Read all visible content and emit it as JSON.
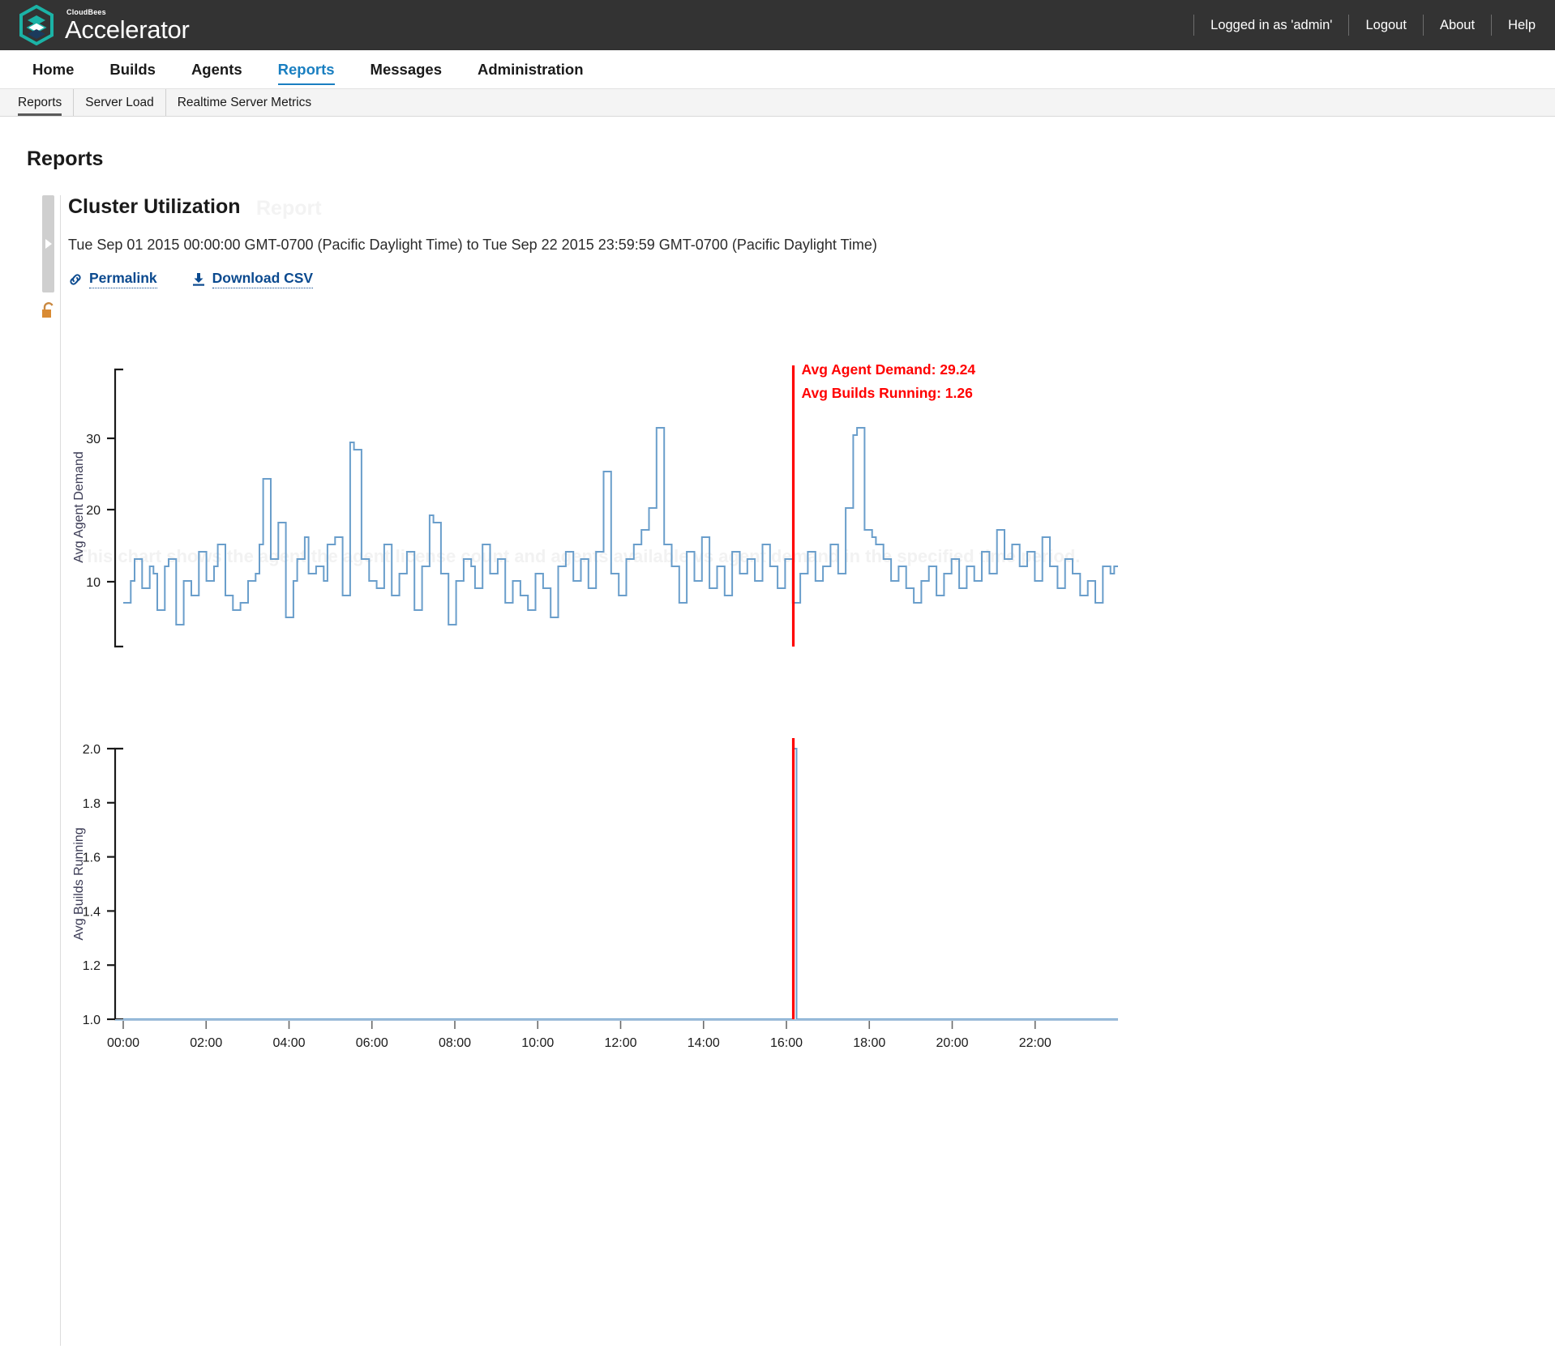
{
  "brand": {
    "sub": "CloudBees",
    "main": "Accelerator",
    "logo_icon": "cloudbees-hexagon-logo",
    "accent": "#1bb3a6"
  },
  "topbar": {
    "background": "#333333",
    "logged_in_as": "Logged in as 'admin'",
    "logout": "Logout",
    "about": "About",
    "help": "Help"
  },
  "mainnav": {
    "items": [
      {
        "label": "Home",
        "active": false
      },
      {
        "label": "Builds",
        "active": false
      },
      {
        "label": "Agents",
        "active": false
      },
      {
        "label": "Reports",
        "active": true
      },
      {
        "label": "Messages",
        "active": false
      },
      {
        "label": "Administration",
        "active": false
      }
    ],
    "active_color": "#1a7fc1"
  },
  "subnav": {
    "items": [
      {
        "label": "Reports",
        "active": true
      },
      {
        "label": "Server Load",
        "active": false
      },
      {
        "label": "Realtime Server Metrics",
        "active": false
      }
    ]
  },
  "page": {
    "title": "Reports"
  },
  "report": {
    "name": "Cluster Utilization",
    "ghost_title": "Report",
    "ghost_description": "This chart shows the agent the agent license count and agents available vs agent demand in the specified time period.",
    "date_range": "Tue Sep 01 2015 00:00:00 GMT-0700 (Pacific Daylight Time) to Tue Sep 22 2015 23:59:59 GMT-0700 (Pacific Daylight Time)",
    "permalink_label": "Permalink",
    "permalink_icon": "link-icon",
    "download_csv_label": "Download CSV",
    "download_csv_icon": "download-icon",
    "splitter_icon": "chevron-right-icon",
    "lock_icon": "unlocked-padlock-icon"
  },
  "chart_data": [
    {
      "type": "line",
      "id": "agent-demand-chart",
      "title": "",
      "xlabel": "",
      "ylabel": "Avg Agent Demand",
      "line_color": "#6a9ecb",
      "interpolation": "step-after",
      "ylim": [
        0,
        38
      ],
      "yticks": [
        10,
        20,
        30
      ],
      "ytick_labels": [
        "10",
        "20",
        "30"
      ],
      "xlim": [
        "00:00",
        "23:59"
      ],
      "xticks": [
        "00:00",
        "02:00",
        "04:00",
        "06:00",
        "08:00",
        "10:00",
        "12:00",
        "14:00",
        "16:00",
        "18:00",
        "20:00",
        "22:00"
      ],
      "grid": false,
      "legend": "none",
      "cursor": {
        "x": "16:10",
        "color": "#ff0000",
        "annotations": [
          "Avg Agent Demand: 29.24",
          "Avg Builds Running: 1.26"
        ]
      },
      "values": [
        6,
        6,
        9,
        12,
        12,
        8,
        8,
        11,
        10,
        5,
        5,
        11,
        12,
        12,
        3,
        3,
        9,
        9,
        7,
        7,
        13,
        13,
        9,
        9,
        11,
        14,
        14,
        7,
        7,
        5,
        5,
        6,
        6,
        9,
        9,
        10,
        14,
        23,
        23,
        12,
        12,
        17,
        17,
        4,
        4,
        9,
        12,
        12,
        15,
        10,
        10,
        11,
        11,
        9,
        14,
        14,
        15,
        15,
        7,
        7,
        28,
        27,
        27,
        12,
        12,
        9,
        9,
        8,
        8,
        14,
        14,
        7,
        7,
        10,
        10,
        13,
        13,
        5,
        5,
        11,
        11,
        18,
        17,
        17,
        10,
        10,
        3,
        3,
        9,
        9,
        12,
        12,
        11,
        8,
        8,
        14,
        14,
        10,
        10,
        12,
        12,
        6,
        6,
        9,
        9,
        7,
        7,
        5,
        5,
        10,
        10,
        8,
        8,
        4,
        4,
        11,
        11,
        13,
        13,
        9,
        9,
        12,
        12,
        8,
        8,
        13,
        13,
        24,
        24,
        10,
        10,
        7,
        7,
        12,
        12,
        14,
        14,
        16,
        16,
        19,
        19,
        30,
        30,
        14,
        14,
        11,
        11,
        6,
        6,
        13,
        13,
        9,
        9,
        15,
        15,
        8,
        8,
        11,
        11,
        7,
        7,
        13,
        13,
        10,
        10,
        12,
        12,
        9,
        9,
        14,
        14,
        11,
        11,
        8,
        8,
        12,
        12,
        6,
        6,
        10,
        10,
        13,
        13,
        9,
        9,
        11,
        11,
        14,
        14,
        10,
        10,
        19,
        19,
        29,
        30,
        30,
        16,
        16,
        15,
        14,
        14,
        12,
        12,
        9,
        9,
        11,
        11,
        8,
        8,
        6,
        6,
        9,
        9,
        11,
        11,
        7,
        7,
        10,
        10,
        12,
        12,
        8,
        8,
        11,
        11,
        9,
        9,
        13,
        13,
        10,
        10,
        16,
        16,
        12,
        12,
        14,
        14,
        11,
        11,
        13,
        13,
        9,
        9,
        15,
        15,
        11,
        11,
        8,
        8,
        12,
        12,
        10,
        10,
        7,
        7,
        9,
        9,
        6,
        6,
        11,
        11,
        10,
        11
      ]
    },
    {
      "type": "line",
      "id": "builds-running-chart",
      "title": "",
      "xlabel": "",
      "ylabel": "Avg Builds Running",
      "line_color": "#6a9ecb",
      "interpolation": "step-after",
      "ylim": [
        1.0,
        2.0
      ],
      "yticks": [
        1.0,
        1.2,
        1.4,
        1.6,
        1.8,
        2.0
      ],
      "ytick_labels": [
        "1.0",
        "1.2",
        "1.4",
        "1.6",
        "1.8",
        "2.0"
      ],
      "xlim": [
        "00:00",
        "23:59"
      ],
      "xticks": [
        "00:00",
        "02:00",
        "04:00",
        "06:00",
        "08:00",
        "10:00",
        "12:00",
        "14:00",
        "16:00",
        "18:00",
        "20:00",
        "22:00"
      ],
      "grid": false,
      "legend": "none",
      "cursor": {
        "x": "16:10",
        "color": "#ff0000"
      },
      "baseline": 1.0,
      "spike": {
        "x": "16:10",
        "value": 2.0
      }
    }
  ]
}
